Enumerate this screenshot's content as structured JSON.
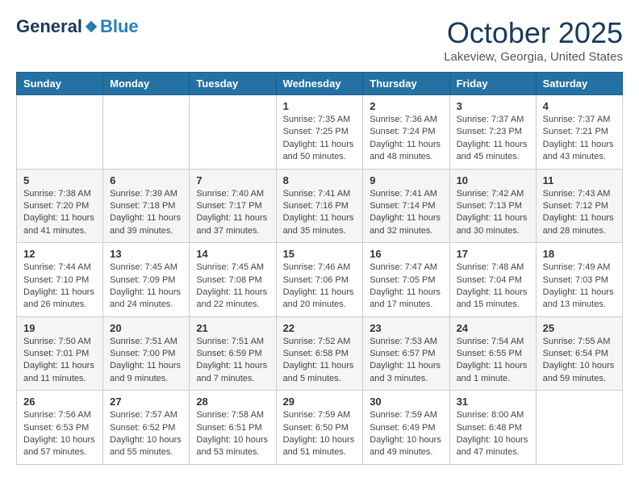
{
  "logo": {
    "general": "General",
    "blue": "Blue"
  },
  "header": {
    "month": "October 2025",
    "location": "Lakeview, Georgia, United States"
  },
  "weekdays": [
    "Sunday",
    "Monday",
    "Tuesday",
    "Wednesday",
    "Thursday",
    "Friday",
    "Saturday"
  ],
  "weeks": [
    [
      {
        "day": "",
        "info": ""
      },
      {
        "day": "",
        "info": ""
      },
      {
        "day": "",
        "info": ""
      },
      {
        "day": "1",
        "info": "Sunrise: 7:35 AM\nSunset: 7:25 PM\nDaylight: 11 hours\nand 50 minutes."
      },
      {
        "day": "2",
        "info": "Sunrise: 7:36 AM\nSunset: 7:24 PM\nDaylight: 11 hours\nand 48 minutes."
      },
      {
        "day": "3",
        "info": "Sunrise: 7:37 AM\nSunset: 7:23 PM\nDaylight: 11 hours\nand 45 minutes."
      },
      {
        "day": "4",
        "info": "Sunrise: 7:37 AM\nSunset: 7:21 PM\nDaylight: 11 hours\nand 43 minutes."
      }
    ],
    [
      {
        "day": "5",
        "info": "Sunrise: 7:38 AM\nSunset: 7:20 PM\nDaylight: 11 hours\nand 41 minutes."
      },
      {
        "day": "6",
        "info": "Sunrise: 7:39 AM\nSunset: 7:18 PM\nDaylight: 11 hours\nand 39 minutes."
      },
      {
        "day": "7",
        "info": "Sunrise: 7:40 AM\nSunset: 7:17 PM\nDaylight: 11 hours\nand 37 minutes."
      },
      {
        "day": "8",
        "info": "Sunrise: 7:41 AM\nSunset: 7:16 PM\nDaylight: 11 hours\nand 35 minutes."
      },
      {
        "day": "9",
        "info": "Sunrise: 7:41 AM\nSunset: 7:14 PM\nDaylight: 11 hours\nand 32 minutes."
      },
      {
        "day": "10",
        "info": "Sunrise: 7:42 AM\nSunset: 7:13 PM\nDaylight: 11 hours\nand 30 minutes."
      },
      {
        "day": "11",
        "info": "Sunrise: 7:43 AM\nSunset: 7:12 PM\nDaylight: 11 hours\nand 28 minutes."
      }
    ],
    [
      {
        "day": "12",
        "info": "Sunrise: 7:44 AM\nSunset: 7:10 PM\nDaylight: 11 hours\nand 26 minutes."
      },
      {
        "day": "13",
        "info": "Sunrise: 7:45 AM\nSunset: 7:09 PM\nDaylight: 11 hours\nand 24 minutes."
      },
      {
        "day": "14",
        "info": "Sunrise: 7:45 AM\nSunset: 7:08 PM\nDaylight: 11 hours\nand 22 minutes."
      },
      {
        "day": "15",
        "info": "Sunrise: 7:46 AM\nSunset: 7:06 PM\nDaylight: 11 hours\nand 20 minutes."
      },
      {
        "day": "16",
        "info": "Sunrise: 7:47 AM\nSunset: 7:05 PM\nDaylight: 11 hours\nand 17 minutes."
      },
      {
        "day": "17",
        "info": "Sunrise: 7:48 AM\nSunset: 7:04 PM\nDaylight: 11 hours\nand 15 minutes."
      },
      {
        "day": "18",
        "info": "Sunrise: 7:49 AM\nSunset: 7:03 PM\nDaylight: 11 hours\nand 13 minutes."
      }
    ],
    [
      {
        "day": "19",
        "info": "Sunrise: 7:50 AM\nSunset: 7:01 PM\nDaylight: 11 hours\nand 11 minutes."
      },
      {
        "day": "20",
        "info": "Sunrise: 7:51 AM\nSunset: 7:00 PM\nDaylight: 11 hours\nand 9 minutes."
      },
      {
        "day": "21",
        "info": "Sunrise: 7:51 AM\nSunset: 6:59 PM\nDaylight: 11 hours\nand 7 minutes."
      },
      {
        "day": "22",
        "info": "Sunrise: 7:52 AM\nSunset: 6:58 PM\nDaylight: 11 hours\nand 5 minutes."
      },
      {
        "day": "23",
        "info": "Sunrise: 7:53 AM\nSunset: 6:57 PM\nDaylight: 11 hours\nand 3 minutes."
      },
      {
        "day": "24",
        "info": "Sunrise: 7:54 AM\nSunset: 6:55 PM\nDaylight: 11 hours\nand 1 minute."
      },
      {
        "day": "25",
        "info": "Sunrise: 7:55 AM\nSunset: 6:54 PM\nDaylight: 10 hours\nand 59 minutes."
      }
    ],
    [
      {
        "day": "26",
        "info": "Sunrise: 7:56 AM\nSunset: 6:53 PM\nDaylight: 10 hours\nand 57 minutes."
      },
      {
        "day": "27",
        "info": "Sunrise: 7:57 AM\nSunset: 6:52 PM\nDaylight: 10 hours\nand 55 minutes."
      },
      {
        "day": "28",
        "info": "Sunrise: 7:58 AM\nSunset: 6:51 PM\nDaylight: 10 hours\nand 53 minutes."
      },
      {
        "day": "29",
        "info": "Sunrise: 7:59 AM\nSunset: 6:50 PM\nDaylight: 10 hours\nand 51 minutes."
      },
      {
        "day": "30",
        "info": "Sunrise: 7:59 AM\nSunset: 6:49 PM\nDaylight: 10 hours\nand 49 minutes."
      },
      {
        "day": "31",
        "info": "Sunrise: 8:00 AM\nSunset: 6:48 PM\nDaylight: 10 hours\nand 47 minutes."
      },
      {
        "day": "",
        "info": ""
      }
    ]
  ]
}
